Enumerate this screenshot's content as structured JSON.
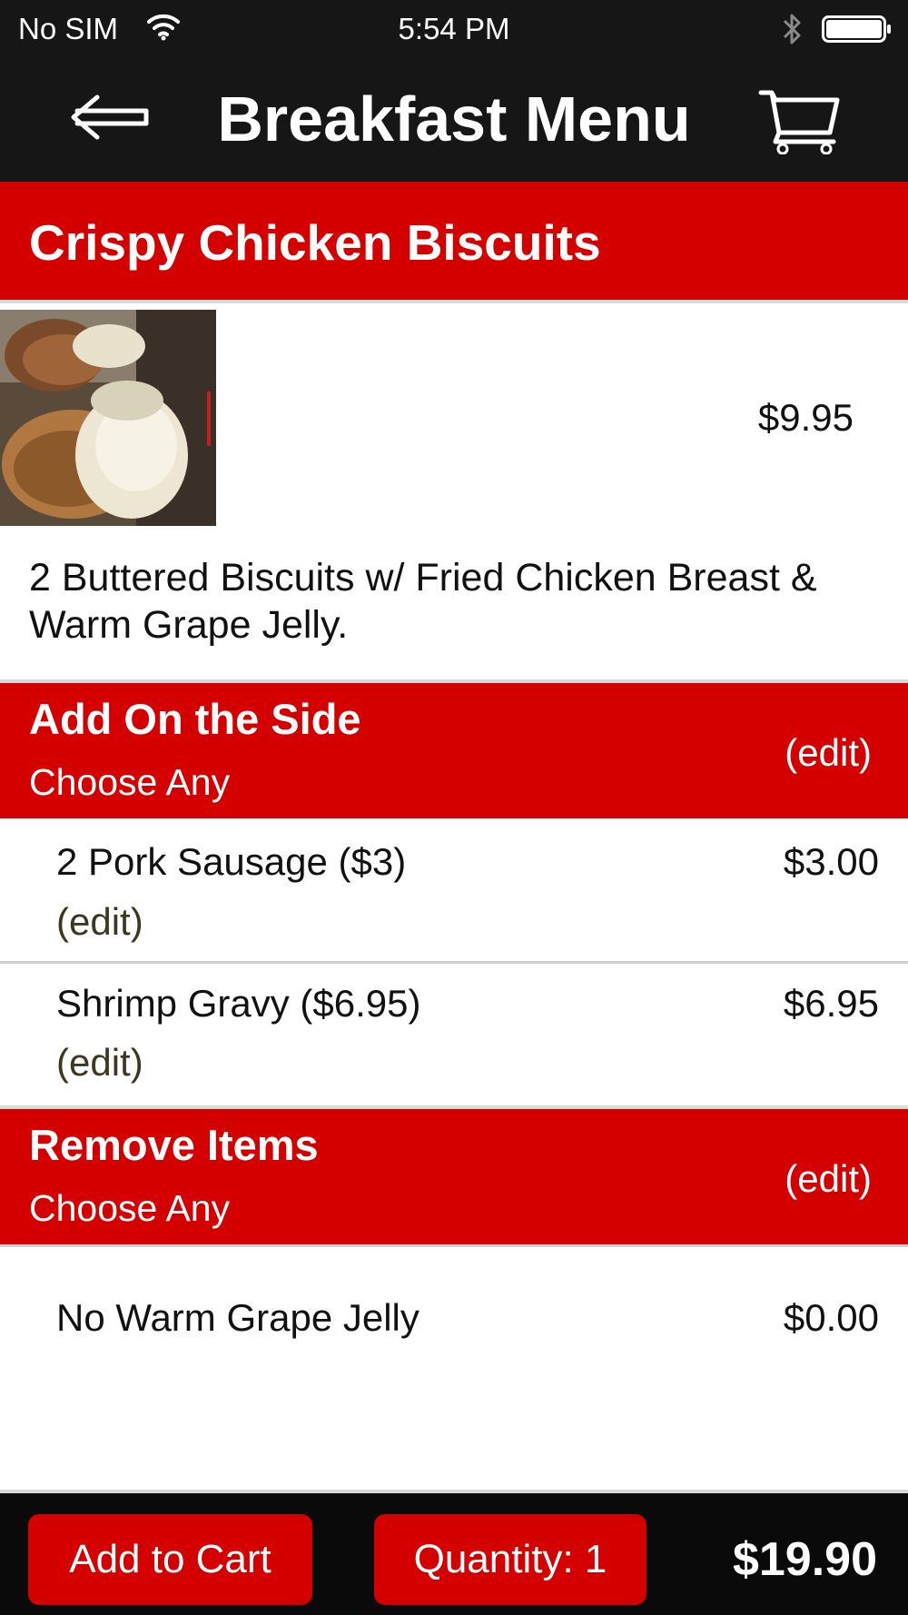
{
  "status_bar": {
    "carrier": "No SIM",
    "time": "5:54 PM",
    "icons": [
      "wifi-icon",
      "bluetooth-icon",
      "battery-icon"
    ]
  },
  "nav": {
    "title": "Breakfast Menu",
    "back_icon": "back-arrow-icon",
    "cart_icon": "cart-icon"
  },
  "item": {
    "name": "Crispy Chicken Biscuits",
    "price": "$9.95",
    "description": "2 Buttered Biscuits w/ Fried Chicken Breast & Warm Grape Jelly."
  },
  "sections": [
    {
      "title": "Add On the Side",
      "subtitle": "Choose Any",
      "edit_label": "(edit)",
      "options": [
        {
          "label": "2 Pork Sausage ($3)",
          "price": "$3.00",
          "edit_label": "(edit)"
        },
        {
          "label": "Shrimp Gravy ($6.95)",
          "price": "$6.95",
          "edit_label": "(edit)"
        }
      ]
    },
    {
      "title": "Remove Items",
      "subtitle": "Choose Any",
      "edit_label": "(edit)",
      "options": [
        {
          "label": "No Warm Grape Jelly",
          "price": "$0.00"
        }
      ]
    }
  ],
  "footer": {
    "add_to_cart_label": "Add to Cart",
    "quantity_label": "Quantity: 1",
    "total": "$19.90"
  },
  "colors": {
    "accent_red": "#d40000",
    "bar_dark": "#161616",
    "footer_dark": "#0a0a0a"
  }
}
